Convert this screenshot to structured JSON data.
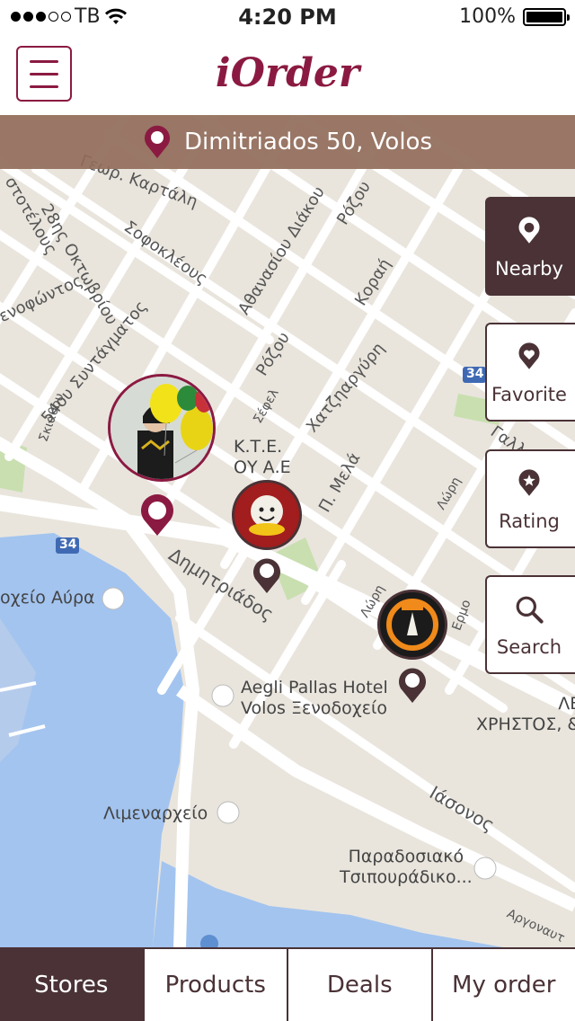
{
  "status_bar": {
    "carrier": "TB",
    "time": "4:20 PM",
    "battery": "100%",
    "battery_level": 1.0
  },
  "header": {
    "title": "iOrder",
    "menu_icon": "hamburger-menu-icon"
  },
  "address": {
    "text": "Dimitriados 50, Volos",
    "icon": "location-pin-icon"
  },
  "filters": [
    {
      "label": "Nearby",
      "icon": "location-pin-icon",
      "active": true
    },
    {
      "label": "Favorite",
      "icon": "heart-pin-icon",
      "active": false
    },
    {
      "label": "Rating",
      "icon": "star-pin-icon",
      "active": false
    },
    {
      "label": "Search",
      "icon": "search-icon",
      "active": false
    }
  ],
  "map": {
    "streets": {
      "karatali": "Γεωρ. Καρτάλη",
      "oktovriou": "28ης Οκτωβρίου",
      "sofokleous": "Σοφοκλέους",
      "athanasiou": "Αθανασίου Διάκου",
      "rozou_top": "Ρόζου",
      "korai": "Κοραή",
      "rozou_mid": "Ρόζου",
      "xatzargiri": "Χατζηαργύρη",
      "syntagmatos": "54ου Συντάγματος",
      "skiathou": "Σκιάθου",
      "sefel": "Σέφελ",
      "p_mela": "Π. Μελά",
      "lorh_top": "Λώρη",
      "lorh_bottom": "Λώρη",
      "dimitriados": "Δημητριάδος",
      "iasonos": "Ιάσονος",
      "arg": "Αργοναυτ",
      "aristotelous": "στοτέλους",
      "mitrofontos": "ενοφώντος",
      "gall": "Γαλλ",
      "erm": "Ερμο",
      "route_34_a": "34",
      "route_34_b": "34"
    },
    "pois": {
      "ktel": "Κ.Τ.Ε.\nΟΥ Α.Ε",
      "avra": "οχείο Αύρα",
      "aegli": "Aegli Pallas Hotel\nVolos Ξενοδοχείο",
      "limenarxeio": "Λιμεναρχείο",
      "tsipouradiko": "Παραδοσιακό\nΤσιπουράδικο...",
      "xristos": "ΛΕ\nΧΡΗΣΤΟΣ, &"
    },
    "colors": {
      "land": "#e9e5dd",
      "water": "#a3c4ef",
      "road": "#ffffff",
      "park": "#c9dfb0",
      "accent": "#8b1a42",
      "brown": "#4a3236"
    },
    "markers": {
      "user_avatar": "user-avatar-marker",
      "store_1": "mikel-coffee-store-marker",
      "store_2": "state-coffee-store-marker"
    }
  },
  "tabs": [
    {
      "label": "Stores",
      "active": true
    },
    {
      "label": "Products",
      "active": false
    },
    {
      "label": "Deals",
      "active": false
    },
    {
      "label": "My order",
      "active": false
    }
  ]
}
